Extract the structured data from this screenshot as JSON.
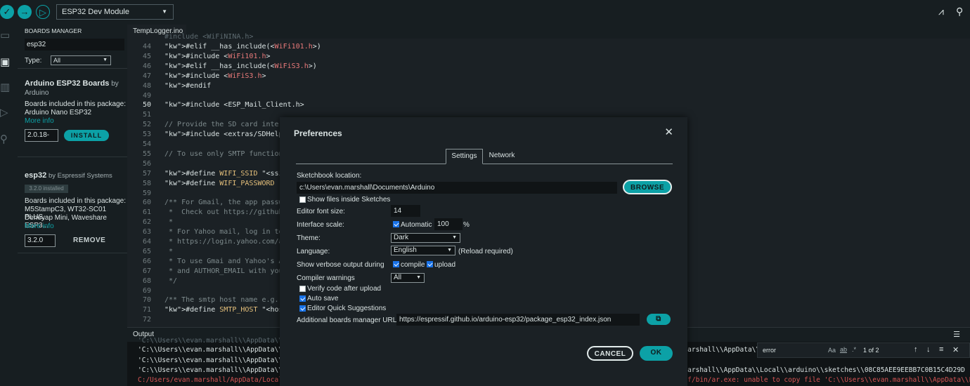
{
  "toolbar": {
    "verify_icon": "check-icon",
    "upload_icon": "arrow-right-icon",
    "debug_icon": "debug-icon",
    "board": "ESP32 Dev Module"
  },
  "boards_manager": {
    "title": "BOARDS MANAGER",
    "search_value": "esp32",
    "type_label": "Type:",
    "type_value": "All",
    "items": [
      {
        "name": "Arduino ESP32 Boards",
        "by": "by",
        "author": "Arduino",
        "included_label": "Boards included in this package:",
        "included": "Arduino Nano ESP32",
        "more_info": "More info",
        "version": "2.0.18-",
        "action": "INSTALL"
      },
      {
        "name": "esp32",
        "by": "by Espressif Systems",
        "badge": "3.2.0 installed",
        "included_label": "Boards included in this package:",
        "included_1": "M5StampC3, WT32-SC01 PLUS,",
        "included_2": "Deneyap Mini, Waveshare ESP3...",
        "more_info": "More info",
        "version": "3.2.0",
        "action": "REMOVE"
      }
    ]
  },
  "editor": {
    "tab": "TempLogger.ino",
    "lines": [
      {
        "n": "44",
        "t": "#elif __has_include(<WiFi101.h>)"
      },
      {
        "n": "45",
        "t": "#include <WiFi101.h>"
      },
      {
        "n": "46",
        "t": "#elif __has_include(<WiFiS3.h>)"
      },
      {
        "n": "47",
        "t": "#include <WiFiS3.h>"
      },
      {
        "n": "48",
        "t": "#endif"
      },
      {
        "n": "49",
        "t": ""
      },
      {
        "n": "50",
        "t": "#include <ESP_Mail_Client.h>"
      },
      {
        "n": "51",
        "t": ""
      },
      {
        "n": "52",
        "t": "// Provide the SD card interfa"
      },
      {
        "n": "53",
        "t": "#include <extras/SDHelper.h>"
      },
      {
        "n": "54",
        "t": ""
      },
      {
        "n": "55",
        "t": "// To use only SMTP functions"
      },
      {
        "n": "56",
        "t": ""
      },
      {
        "n": "57",
        "t": "#define WIFI_SSID \"<ssid>\""
      },
      {
        "n": "58",
        "t": "#define WIFI_PASSWORD \"<passwo"
      },
      {
        "n": "59",
        "t": ""
      },
      {
        "n": "60",
        "t": "/** For Gmail, the app passwo"
      },
      {
        "n": "61",
        "t": " *  Check out https://github."
      },
      {
        "n": "62",
        "t": " *"
      },
      {
        "n": "63",
        "t": " * For Yahoo mail, log in to y"
      },
      {
        "n": "64",
        "t": " * https://login.yahoo.com/acc"
      },
      {
        "n": "65",
        "t": " *"
      },
      {
        "n": "66",
        "t": " * To use Gmai and Yahoo's App"
      },
      {
        "n": "67",
        "t": " * and AUTHOR_EMAIL with your"
      },
      {
        "n": "68",
        "t": " */"
      },
      {
        "n": "69",
        "t": ""
      },
      {
        "n": "70",
        "t": "/** The smtp host name e.g. sm"
      },
      {
        "n": "71",
        "t": "#define SMTP_HOST \"<host>\""
      },
      {
        "n": "72",
        "t": ""
      }
    ]
  },
  "output": {
    "title": "Output",
    "left_lines": [
      "'C:\\\\Users\\\\evan.marshall\\\\AppData\\\\",
      "'C:\\\\Users\\\\evan.marshall\\\\AppData\\\\",
      "'C:\\\\Users\\\\evan.marshall\\\\AppData\\\\",
      "C:/Users/evan.marshall/AppData/Local"
    ],
    "right_lines": [
      "e.marshall\\\\AppData\\\\Local\\\\arduino\\\\sketches\\\\08C85AEE9EEBB7C0B15C4D29D",
      "e.marshall\\\\AppData\\\\Local\\\\arduino\\\\sketches\\\\08C85AEE9EEBB7C0B15C4D29D",
      "-elf/bin/ar.exe: unable to copy file 'C:\\\\Users\\\\evan.marshall\\\\AppData\\\\Lo"
    ],
    "find_value": "error",
    "find_count": "1 of 2"
  },
  "preferences": {
    "title": "Preferences",
    "tab_settings": "Settings",
    "tab_network": "Network",
    "sketchbook_label": "Sketchbook location:",
    "sketchbook_value": "c:\\Users\\evan.marshall\\Documents\\Arduino",
    "browse": "BROWSE",
    "show_files": "Show files inside Sketches",
    "font_size_label": "Editor font size:",
    "font_size_value": "14",
    "scale_label": "Interface scale:",
    "automatic": "Automatic",
    "scale_value": "100",
    "percent": "%",
    "theme_label": "Theme:",
    "theme_value": "Dark",
    "language_label": "Language:",
    "language_value": "English",
    "reload_note": "(Reload required)",
    "verbose_label": "Show verbose output during",
    "compile": "compile",
    "upload": "upload",
    "warnings_label": "Compiler warnings",
    "warnings_value": "All",
    "verify_after": "Verify code after upload",
    "auto_save": "Auto save",
    "quick_suggest": "Editor Quick Suggestions",
    "urls_label": "Additional boards manager URLs:",
    "urls_value": "https://espressif.github.io/arduino-esp32/package_esp32_index.json",
    "cancel": "CANCEL",
    "ok": "OK"
  },
  "colors": {
    "accent": "#0ca1a6",
    "background": "#1b2125",
    "panel": "#171e21"
  }
}
